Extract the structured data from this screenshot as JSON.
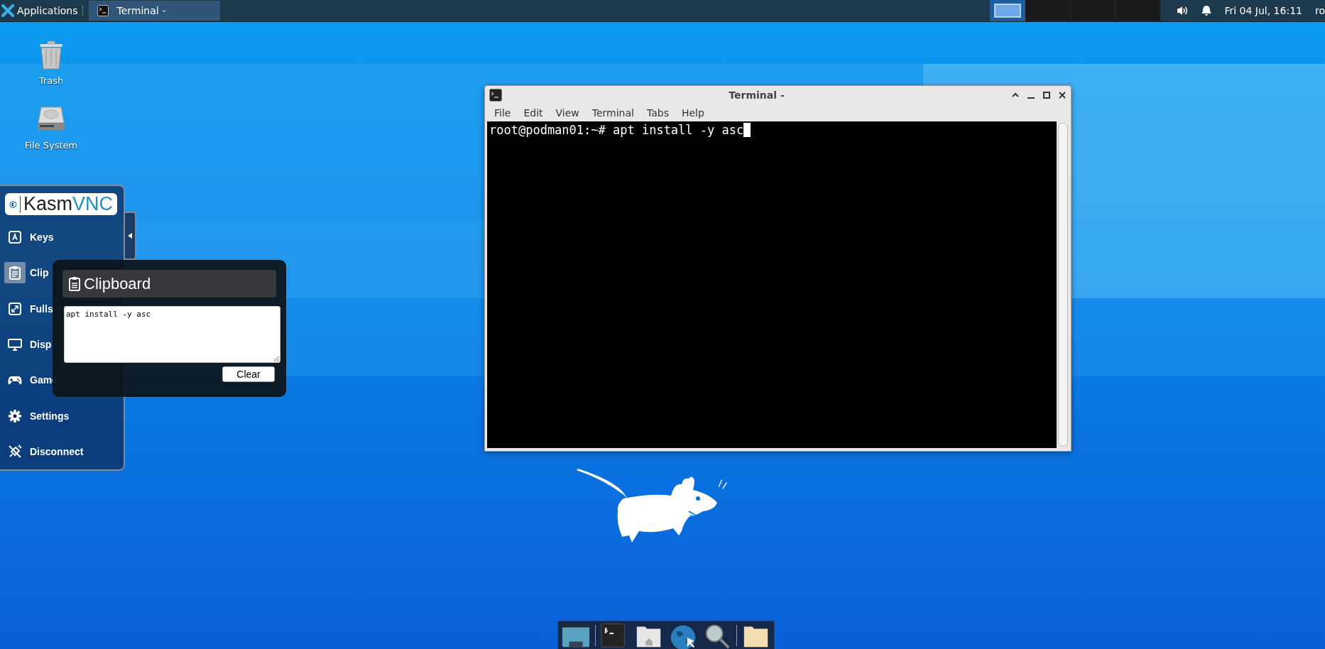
{
  "top_panel": {
    "applications": "Applications",
    "tasks": [
      {
        "label": "Terminal -",
        "selected": true
      }
    ],
    "clock": "Fri 04 Jul, 16:11",
    "user": "ro"
  },
  "desktop_icons": [
    {
      "label": "Trash",
      "kind": "trash"
    },
    {
      "label": "File System",
      "kind": "drive"
    }
  ],
  "kasm_panel": {
    "logo": [
      "Kasm",
      "VNC"
    ],
    "items": [
      {
        "label": "Keys",
        "selected": false
      },
      {
        "label": "Clip",
        "selected": true
      },
      {
        "label": "Fulls",
        "selected": false
      },
      {
        "label": "Disp",
        "selected": false
      },
      {
        "label": "Game",
        "selected": false
      },
      {
        "label": "Settings",
        "selected": false
      },
      {
        "label": "Disconnect",
        "selected": false
      }
    ]
  },
  "clipboard": {
    "title": "Clipboard",
    "text": "apt install -y asc",
    "button": "Clear"
  },
  "terminal": {
    "title": "Terminal -",
    "menu": [
      "File",
      "Edit",
      "View",
      "Terminal",
      "Tabs",
      "Help"
    ],
    "lines": [
      "root@podman01:~# apt install -y asc"
    ]
  }
}
